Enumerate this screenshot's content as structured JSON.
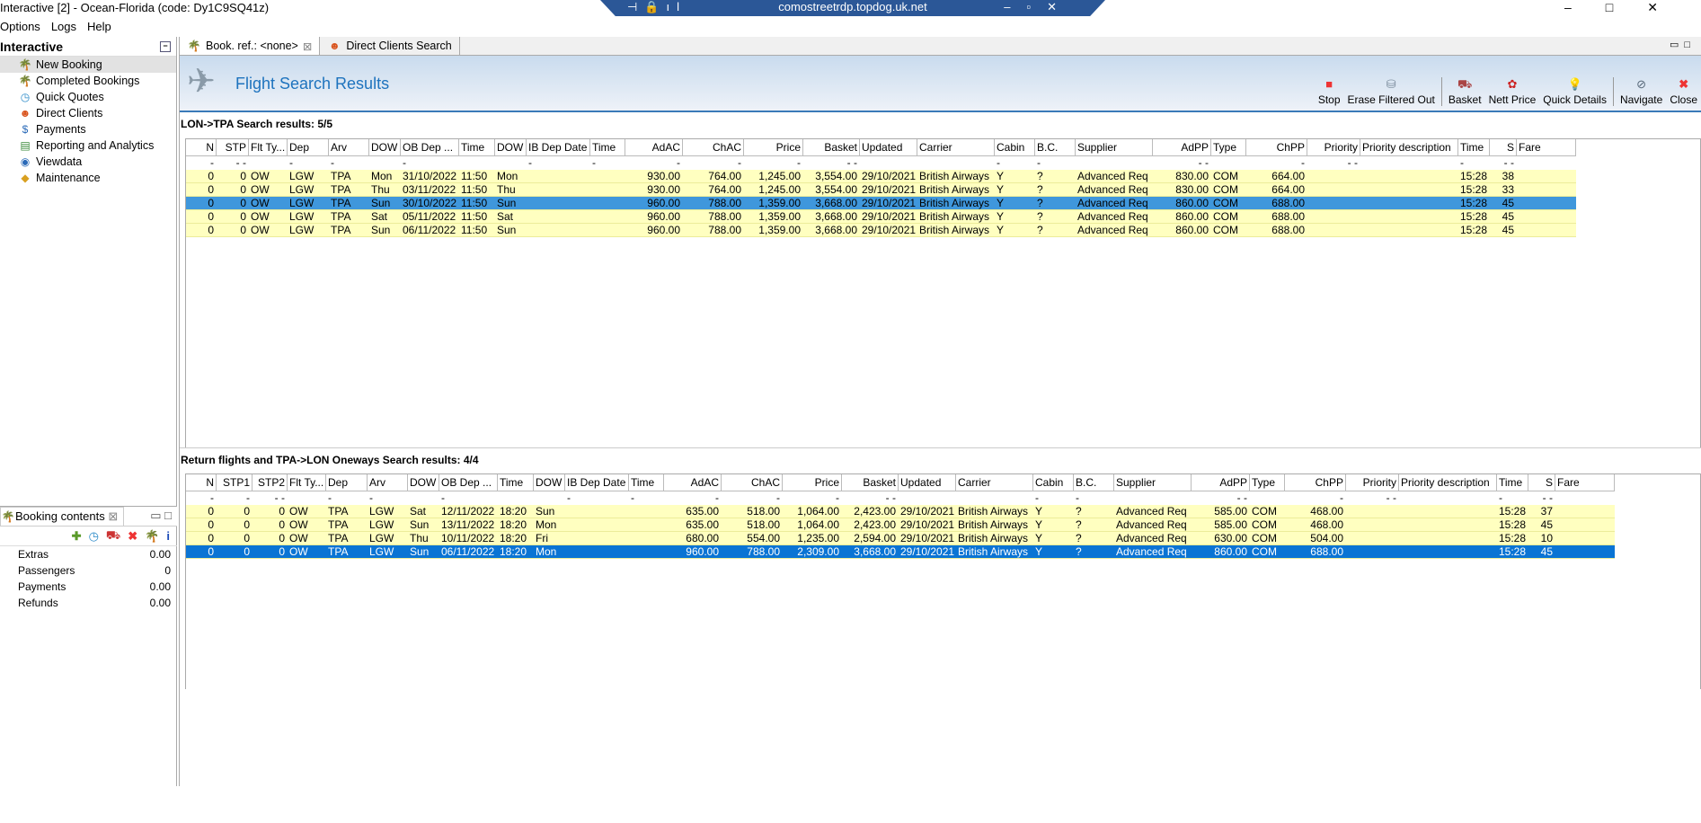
{
  "window": {
    "title": "Interactive [2] - Ocean-Florida (code: Dy1C9SQ41z)",
    "rdp_host": "comostreetrdp.topdog.uk.net"
  },
  "menu": [
    "Options",
    "Logs",
    "Help"
  ],
  "sidebar": {
    "title": "Interactive",
    "items": [
      {
        "label": "New Booking",
        "icon": "palm-tree-icon"
      },
      {
        "label": "Completed Bookings",
        "icon": "palm-tree-icon"
      },
      {
        "label": "Quick Quotes",
        "icon": "clock-icon"
      },
      {
        "label": "Direct Clients",
        "icon": "person-icon"
      },
      {
        "label": "Payments",
        "icon": "dollar-icon"
      },
      {
        "label": "Reporting and Analytics",
        "icon": "report-icon"
      },
      {
        "label": "Viewdata",
        "icon": "globe-icon"
      },
      {
        "label": "Maintenance",
        "icon": "box-icon"
      }
    ]
  },
  "booking_contents": {
    "title": "Booking contents",
    "rows": [
      {
        "label": "Extras",
        "value": "0.00"
      },
      {
        "label": "Passengers",
        "value": "0"
      },
      {
        "label": "Payments",
        "value": "0.00"
      },
      {
        "label": "Refunds",
        "value": "0.00"
      }
    ]
  },
  "tabs": [
    {
      "label": "Book. ref.: <none>"
    },
    {
      "label": "Direct Clients Search"
    }
  ],
  "header": {
    "title": "Flight Search Results"
  },
  "toolbar": [
    "Stop",
    "Erase Filtered Out",
    "Basket",
    "Nett Price",
    "Quick Details",
    "Navigate",
    "Close"
  ],
  "outbound": {
    "label": "LON->TPA Search results: 5/5",
    "columns": [
      "N",
      "STP",
      "Flt Ty...",
      "Dep",
      "Arv",
      "DOW",
      "OB Dep ...",
      "Time",
      "DOW",
      "IB Dep Date",
      "Time",
      "AdAC",
      "ChAC",
      "Price",
      "Basket",
      "Updated",
      "Carrier",
      "Cabin",
      "B.C.",
      "Supplier",
      "AdPP",
      "Type",
      "ChPP",
      "Priority",
      "Priority description",
      "Time",
      "S",
      "Fare"
    ],
    "filter": [
      "-",
      "- -",
      "",
      "-",
      "-",
      "",
      "-",
      "",
      "",
      "-",
      "-",
      "-",
      "-",
      "-",
      "- -",
      "",
      "",
      "-",
      "-",
      "",
      "- -",
      "",
      "-",
      "- -",
      "",
      "-",
      "- -",
      ""
    ],
    "rows": [
      [
        "0",
        "0",
        "OW",
        "LGW",
        "TPA",
        "Mon",
        "31/10/2022",
        "11:50",
        "Mon",
        "",
        "",
        "930.00",
        "764.00",
        "1,245.00",
        "3,554.00",
        "29/10/2021",
        "British Airways",
        "Y",
        "?",
        "Advanced Req",
        "830.00",
        "COM",
        "664.00",
        "",
        "",
        "15:28",
        "38",
        ""
      ],
      [
        "0",
        "0",
        "OW",
        "LGW",
        "TPA",
        "Thu",
        "03/11/2022",
        "11:50",
        "Thu",
        "",
        "",
        "930.00",
        "764.00",
        "1,245.00",
        "3,554.00",
        "29/10/2021",
        "British Airways",
        "Y",
        "?",
        "Advanced Req",
        "830.00",
        "COM",
        "664.00",
        "",
        "",
        "15:28",
        "33",
        ""
      ],
      [
        "0",
        "0",
        "OW",
        "LGW",
        "TPA",
        "Sun",
        "30/10/2022",
        "11:50",
        "Sun",
        "",
        "",
        "960.00",
        "788.00",
        "1,359.00",
        "3,668.00",
        "29/10/2021",
        "British Airways",
        "Y",
        "?",
        "Advanced Req",
        "860.00",
        "COM",
        "688.00",
        "",
        "",
        "15:28",
        "45",
        ""
      ],
      [
        "0",
        "0",
        "OW",
        "LGW",
        "TPA",
        "Sat",
        "05/11/2022",
        "11:50",
        "Sat",
        "",
        "",
        "960.00",
        "788.00",
        "1,359.00",
        "3,668.00",
        "29/10/2021",
        "British Airways",
        "Y",
        "?",
        "Advanced Req",
        "860.00",
        "COM",
        "688.00",
        "",
        "",
        "15:28",
        "45",
        ""
      ],
      [
        "0",
        "0",
        "OW",
        "LGW",
        "TPA",
        "Sun",
        "06/11/2022",
        "11:50",
        "Sun",
        "",
        "",
        "960.00",
        "788.00",
        "1,359.00",
        "3,668.00",
        "29/10/2021",
        "British Airways",
        "Y",
        "?",
        "Advanced Req",
        "860.00",
        "COM",
        "688.00",
        "",
        "",
        "15:28",
        "45",
        ""
      ]
    ],
    "selected": 2
  },
  "return": {
    "label": "Return flights and TPA->LON Oneways Search results: 4/4",
    "columns": [
      "N",
      "STP1",
      "STP2",
      "Flt Ty...",
      "Dep",
      "Arv",
      "DOW",
      "OB Dep ...",
      "Time",
      "DOW",
      "IB Dep Date",
      "Time",
      "AdAC",
      "ChAC",
      "Price",
      "Basket",
      "Updated",
      "Carrier",
      "Cabin",
      "B.C.",
      "Supplier",
      "AdPP",
      "Type",
      "ChPP",
      "Priority",
      "Priority description",
      "Time",
      "S",
      "Fare"
    ],
    "filter": [
      "-",
      "-",
      "- -",
      "",
      "-",
      "-",
      "",
      "-",
      "",
      "",
      "-",
      "-",
      "-",
      "-",
      "-",
      "- -",
      "",
      "",
      "-",
      "-",
      "",
      "- -",
      "",
      "-",
      "- -",
      "",
      "-",
      "- -",
      ""
    ],
    "rows": [
      [
        "0",
        "0",
        "0",
        "OW",
        "TPA",
        "LGW",
        "Sat",
        "12/11/2022",
        "18:20",
        "Sun",
        "",
        "",
        "635.00",
        "518.00",
        "1,064.00",
        "2,423.00",
        "29/10/2021",
        "British Airways",
        "Y",
        "?",
        "Advanced Req",
        "585.00",
        "COM",
        "468.00",
        "",
        "",
        "15:28",
        "37",
        ""
      ],
      [
        "0",
        "0",
        "0",
        "OW",
        "TPA",
        "LGW",
        "Sun",
        "13/11/2022",
        "18:20",
        "Mon",
        "",
        "",
        "635.00",
        "518.00",
        "1,064.00",
        "2,423.00",
        "29/10/2021",
        "British Airways",
        "Y",
        "?",
        "Advanced Req",
        "585.00",
        "COM",
        "468.00",
        "",
        "",
        "15:28",
        "45",
        ""
      ],
      [
        "0",
        "0",
        "0",
        "OW",
        "TPA",
        "LGW",
        "Thu",
        "10/11/2022",
        "18:20",
        "Fri",
        "",
        "",
        "680.00",
        "554.00",
        "1,235.00",
        "2,594.00",
        "29/10/2021",
        "British Airways",
        "Y",
        "?",
        "Advanced Req",
        "630.00",
        "COM",
        "504.00",
        "",
        "",
        "15:28",
        "10",
        ""
      ],
      [
        "0",
        "0",
        "0",
        "OW",
        "TPA",
        "LGW",
        "Sun",
        "06/11/2022",
        "18:20",
        "Mon",
        "",
        "",
        "960.00",
        "788.00",
        "2,309.00",
        "3,668.00",
        "29/10/2021",
        "British Airways",
        "Y",
        "?",
        "Advanced Req",
        "860.00",
        "COM",
        "688.00",
        "",
        "",
        "15:28",
        "45",
        ""
      ]
    ],
    "selected": 3
  }
}
